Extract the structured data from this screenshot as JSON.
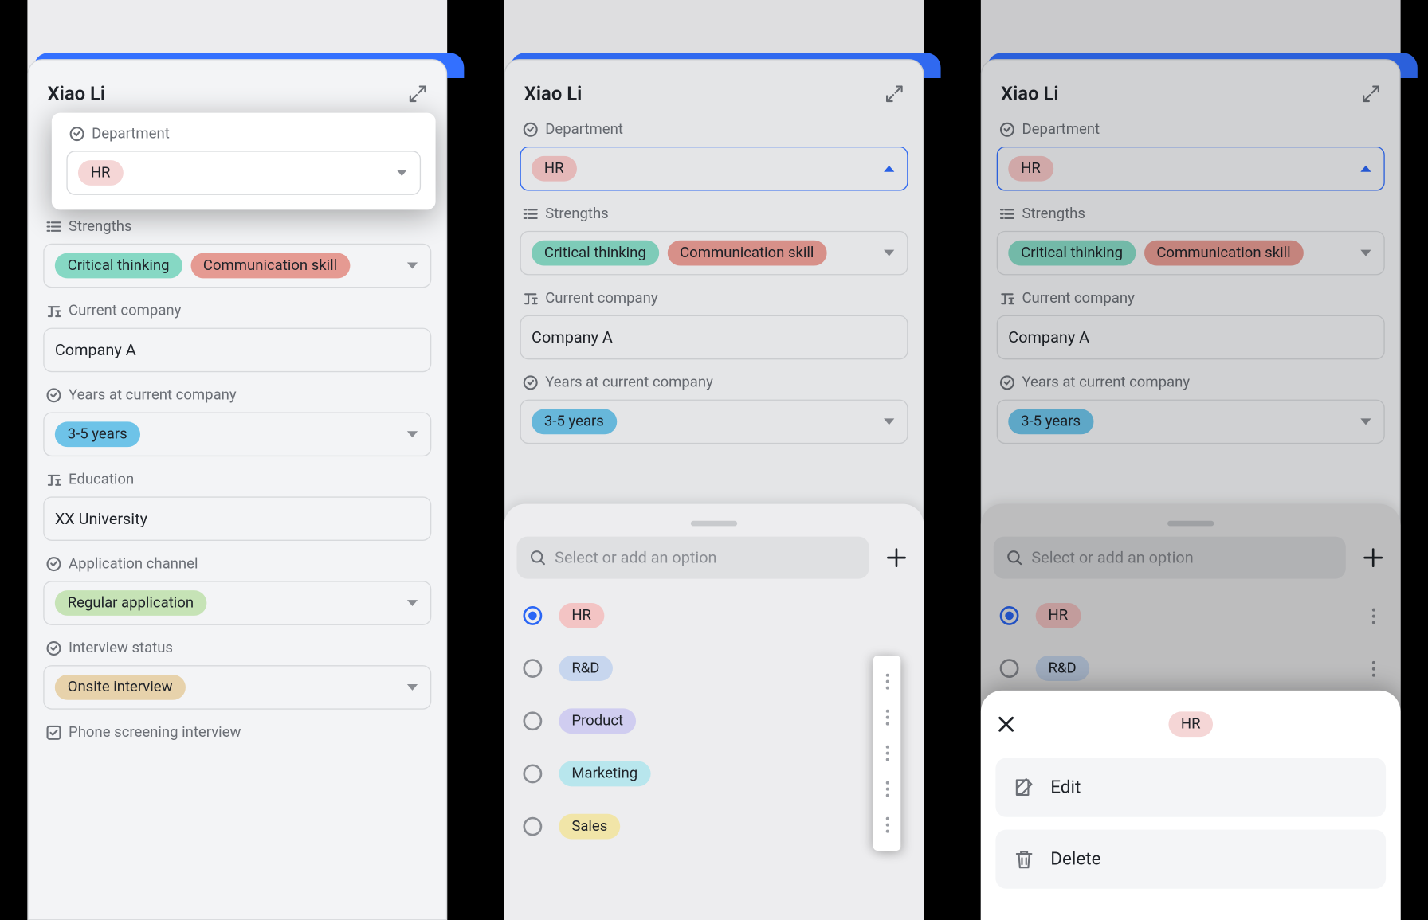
{
  "person": "Xiao Li",
  "labels": {
    "department": "Department",
    "strengths": "Strengths",
    "currentCompany": "Current company",
    "years": "Years at current company",
    "education": "Education",
    "channel": "Application channel",
    "status": "Interview status",
    "phone": "Phone screening interview"
  },
  "values": {
    "department": "HR",
    "strengths": [
      "Critical thinking",
      "Communication skill"
    ],
    "currentCompany": "Company A",
    "years": "3-5 years",
    "education": "XX University",
    "channel": "Regular application",
    "status": "Onsite interview"
  },
  "picker": {
    "placeholder": "Select or add an option",
    "selected": "HR",
    "options": [
      "HR",
      "R&D",
      "Product",
      "Marketing",
      "Sales"
    ]
  },
  "actions": {
    "edit": "Edit",
    "delete": "Delete",
    "contextPill": "HR"
  }
}
